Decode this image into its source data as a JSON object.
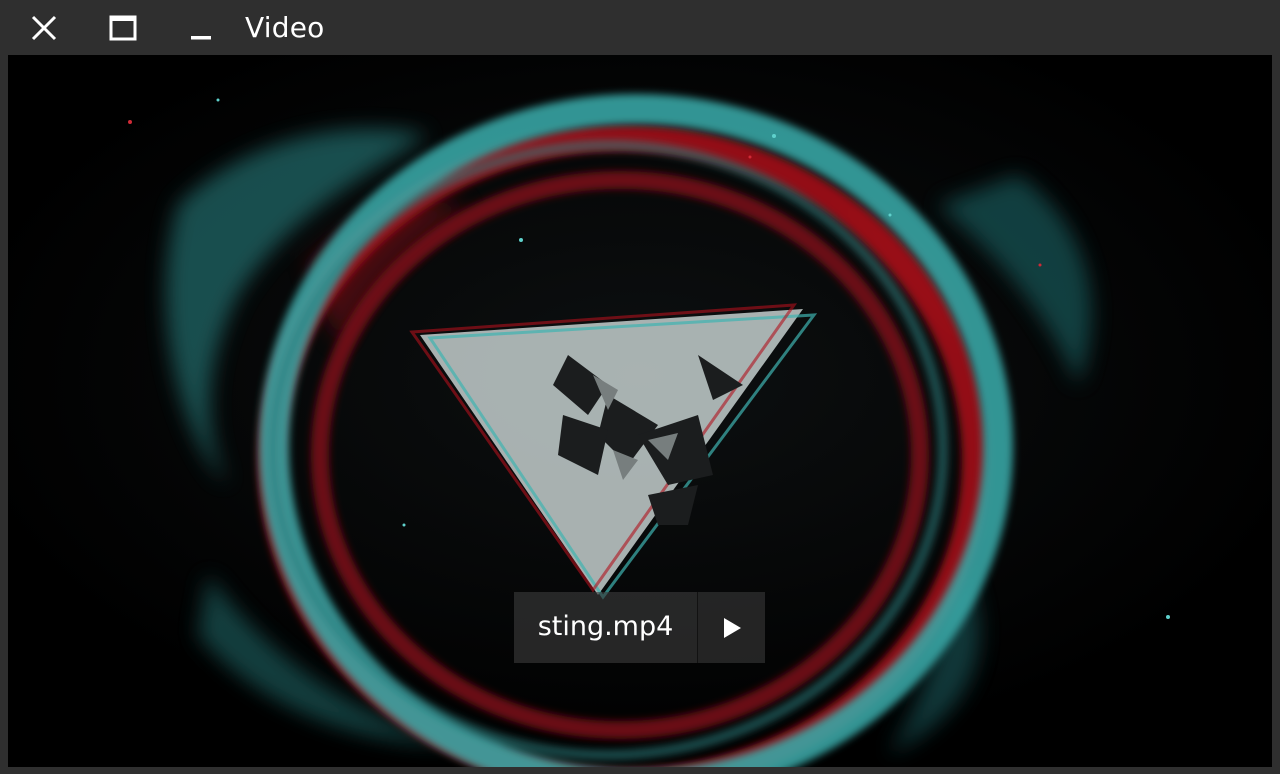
{
  "window": {
    "title": "Video"
  },
  "titlebar": {
    "buttons": [
      {
        "name": "close",
        "icon": "close-icon"
      },
      {
        "name": "maximize",
        "icon": "maximize-icon"
      },
      {
        "name": "minimize",
        "icon": "minimize-icon"
      }
    ]
  },
  "player": {
    "file_name": "sting.mp4",
    "play_icon": "play-icon"
  },
  "colors": {
    "chrome": "#2f2f2f",
    "video_bg": "#000000",
    "accent_teal": "#38b3b0",
    "accent_red": "#b0101c",
    "logo": "#b9bdbd"
  }
}
